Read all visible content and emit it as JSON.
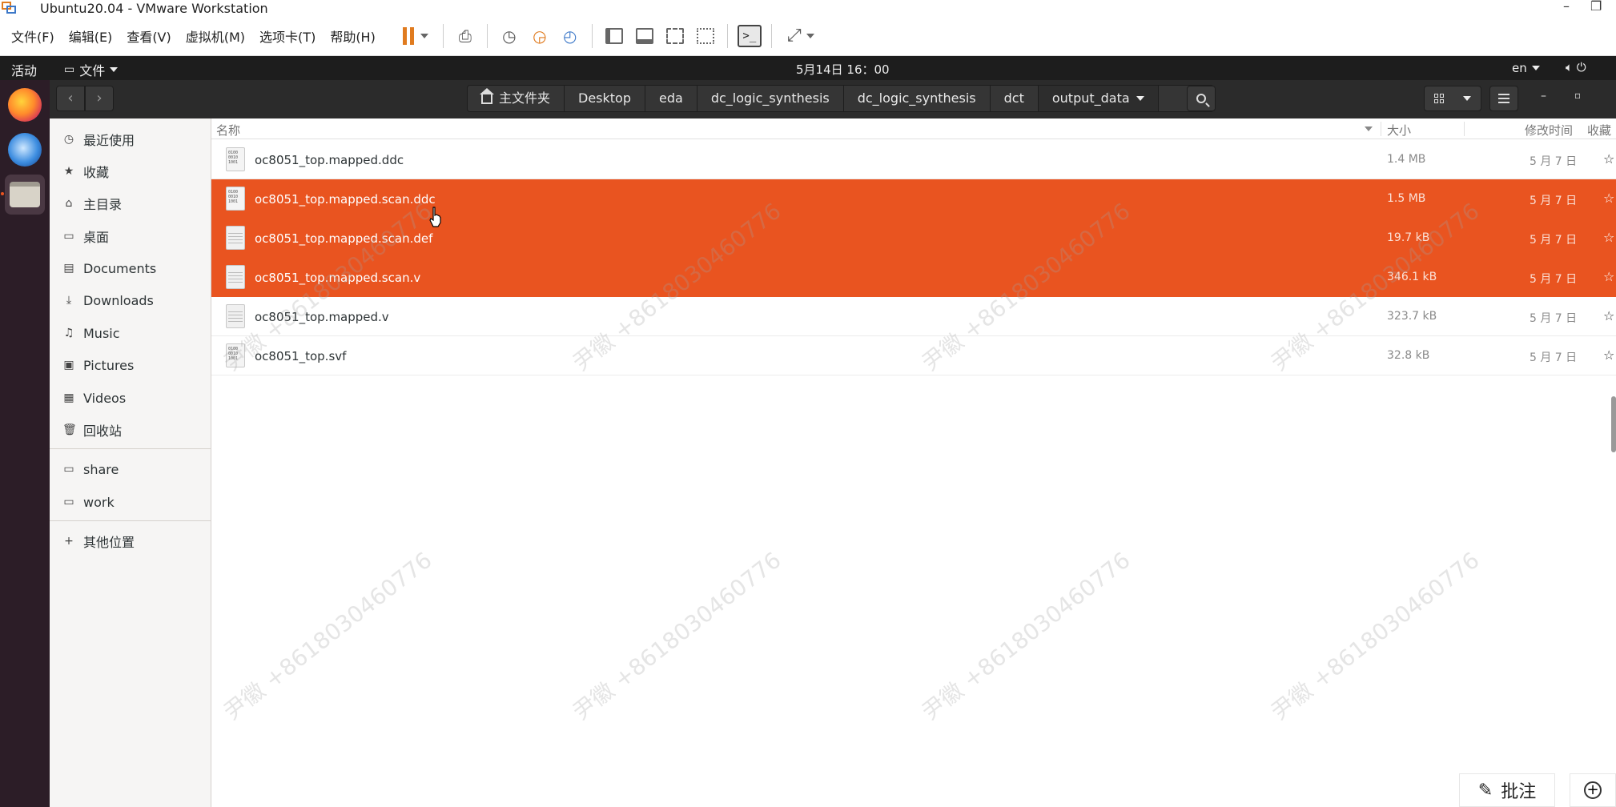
{
  "window": {
    "title": "Ubuntu20.04 - VMware Workstation"
  },
  "vm_menu": [
    "文件(F)",
    "编辑(E)",
    "查看(V)",
    "虚拟机(M)",
    "选项卡(T)",
    "帮助(H)"
  ],
  "ubuntu_bar": {
    "activities": "活动",
    "app_menu": "文件",
    "clock": "5月14日  16：00",
    "lang": "en"
  },
  "breadcrumbs": [
    "主文件夹",
    "Desktop",
    "eda",
    "dc_logic_synthesis",
    "dc_logic_synthesis",
    "dct",
    "output_data"
  ],
  "sidebar": {
    "items": [
      {
        "label": "最近使用",
        "icon": "clock-icon"
      },
      {
        "label": "收藏",
        "icon": "star-icon"
      },
      {
        "label": "主目录",
        "icon": "home-icon"
      },
      {
        "label": "桌面",
        "icon": "desktop-icon"
      },
      {
        "label": "Documents",
        "icon": "documents-icon"
      },
      {
        "label": "Downloads",
        "icon": "downloads-icon"
      },
      {
        "label": "Music",
        "icon": "music-icon"
      },
      {
        "label": "Pictures",
        "icon": "pictures-icon"
      },
      {
        "label": "Videos",
        "icon": "videos-icon"
      },
      {
        "label": "回收站",
        "icon": "trash-icon"
      }
    ],
    "bookmarks": [
      {
        "label": "share",
        "icon": "folder-icon"
      },
      {
        "label": "work",
        "icon": "folder-icon"
      }
    ],
    "other": {
      "label": "其他位置",
      "icon": "plus-icon"
    }
  },
  "columns": {
    "name": "名称",
    "size": "大小",
    "modified": "修改时间",
    "starred": "收藏"
  },
  "files": [
    {
      "name": "oc8051_top.mapped.ddc",
      "size": "1.4 MB",
      "date": "5 月 7 日",
      "selected": false,
      "icon": "binary"
    },
    {
      "name": "oc8051_top.mapped.scan.ddc",
      "size": "1.5 MB",
      "date": "5 月 7 日",
      "selected": true,
      "icon": "binary"
    },
    {
      "name": "oc8051_top.mapped.scan.def",
      "size": "19.7 kB",
      "date": "5 月 7 日",
      "selected": true,
      "icon": "text"
    },
    {
      "name": "oc8051_top.mapped.scan.v",
      "size": "346.1 kB",
      "date": "5 月 7 日",
      "selected": true,
      "icon": "text"
    },
    {
      "name": "oc8051_top.mapped.v",
      "size": "323.7 kB",
      "date": "5 月 7 日",
      "selected": false,
      "icon": "text"
    },
    {
      "name": "oc8051_top.svf",
      "size": "32.8 kB",
      "date": "5 月 7 日",
      "selected": false,
      "icon": "binary"
    }
  ],
  "binary_icon_text": "0100\n0010\n1001",
  "watermark": "尹徽 +8618030460776",
  "bottom_tools": {
    "annotate": "批注"
  },
  "colors": {
    "accent": "#e95420",
    "dock": "#2c1d27",
    "header": "#2b2b2b"
  }
}
